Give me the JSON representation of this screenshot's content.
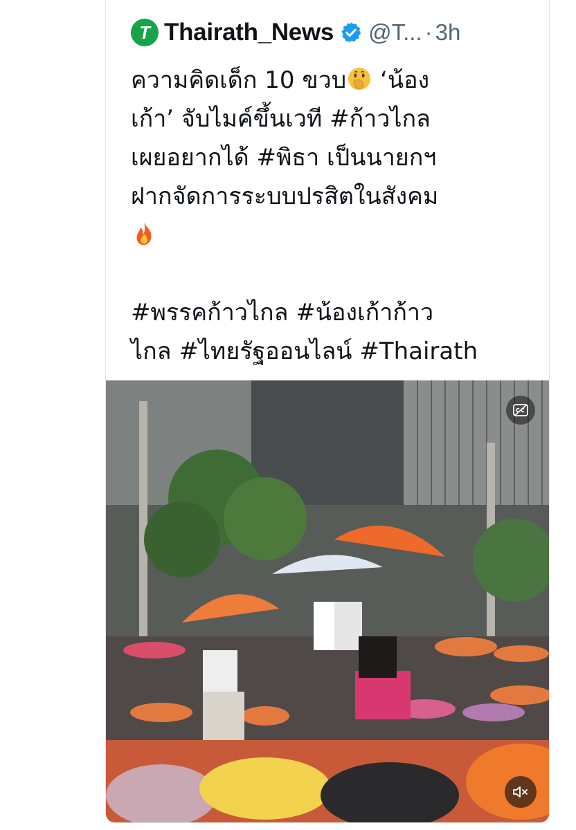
{
  "tweet": {
    "author": {
      "display_name": "Thairath_News",
      "handle": "@T...",
      "logo_letter": "T",
      "verified_icon": "verified-badge-icon"
    },
    "separator": "·",
    "time": "3h",
    "text_lines": {
      "line1": "ความคิดเด็ก 10 ขวบ",
      "line1_end": " ‘น้อง",
      "line2": "เก้า’ จับไมค์ขึ้นเวที #ก้าวไกล",
      "line3": "เผยอยากได้ #พิธา เป็นนายกฯ",
      "line4": "ฝากจัดการระบบปรสิตในสังคม",
      "line6": "#พรรคก้าวไกล #น้องเก้าก้าว",
      "line7": "ไกล #ไทยรัฐออนไลน์ #Thairath"
    },
    "emojis": [
      "face-with-hand-over-mouth-icon",
      "fire-icon"
    ]
  },
  "media": {
    "type": "video",
    "description_icon": "video-thumbnail",
    "controls": [
      "closed-captions-icon",
      "mute-icon"
    ]
  },
  "colors": {
    "brand_green": "#16a34a",
    "verified_blue": "#1d9bf0",
    "text": "#0f1419",
    "secondary": "#536471"
  }
}
